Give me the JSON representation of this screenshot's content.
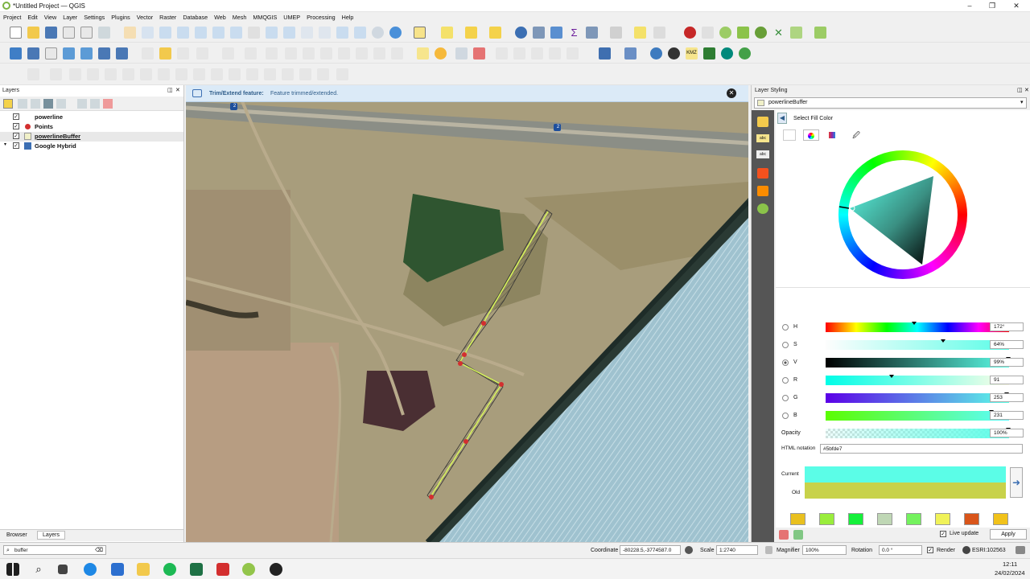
{
  "window": {
    "title": "*Untitled Project — QGIS"
  },
  "menu": [
    "Project",
    "Edit",
    "View",
    "Layer",
    "Settings",
    "Plugins",
    "Vector",
    "Raster",
    "Database",
    "Web",
    "Mesh",
    "MMQGIS",
    "UMEP",
    "Processing",
    "Help"
  ],
  "layers_panel": {
    "title": "Layers",
    "items": [
      {
        "name": "powerline",
        "checked": true
      },
      {
        "name": "Points",
        "checked": true
      },
      {
        "name": "powerlineBuffer",
        "checked": true
      },
      {
        "name": "Google Hybrid",
        "checked": true
      }
    ],
    "tabs": [
      "Browser",
      "Layers"
    ],
    "search_value": "buffer"
  },
  "message": {
    "title": "Trim/Extend feature:",
    "text": "Feature trimmed/extended."
  },
  "map": {
    "road_badge_1": "2",
    "road_badge_2": "2"
  },
  "styling": {
    "title": "Layer Styling",
    "layer_select": "powerlineBuffer",
    "header": "Select Fill Color",
    "channels": [
      {
        "label": "H",
        "value": "172°"
      },
      {
        "label": "S",
        "value": "64%"
      },
      {
        "label": "V",
        "value": "99%"
      },
      {
        "label": "R",
        "value": "91"
      },
      {
        "label": "G",
        "value": "253"
      },
      {
        "label": "B",
        "value": "231"
      }
    ],
    "opacity_label": "Opacity",
    "opacity_value": "100%",
    "html_label": "HTML notation",
    "html_value": "#5bfde7",
    "current_label": "Current",
    "old_label": "Old",
    "current_color": "#5bfde7",
    "old_color": "#c8d24a",
    "swatches": [
      "#e9c01f",
      "#9aed3c",
      "#15f03a",
      "#bfd7b5",
      "#74f25e",
      "#f0f258",
      "#d9551a",
      "#f1c21a",
      "#c7a62e",
      "#eec21b",
      "#e9f652",
      "#63f4dc",
      "#61c6ee",
      "#1a72e8",
      "#1815d9",
      "#1b9ec5"
    ],
    "live_update_label": "Live update",
    "apply_label": "Apply"
  },
  "status": {
    "coordinate_label": "Coordinate",
    "coordinate_value": "-80228.5,-3774587.0",
    "scale_label": "Scale",
    "scale_value": "1:2740",
    "magnifier_label": "Magnifier",
    "magnifier_value": "100%",
    "rotation_label": "Rotation",
    "rotation_value": "0.0 °",
    "render_label": "Render",
    "crs": "ESRI:102563"
  },
  "taskbar": {
    "time": "12:11",
    "date": "24/02/2024"
  }
}
